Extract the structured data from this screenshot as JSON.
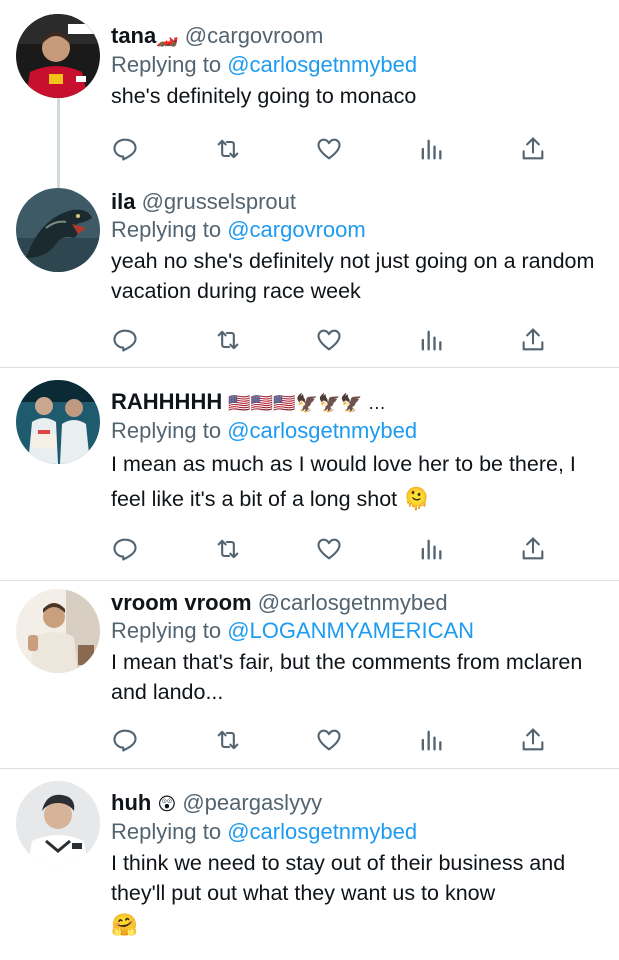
{
  "tweets": [
    {
      "name": "tana",
      "name_suffix": "🏎️",
      "handle": "@cargovroom",
      "replying_prefix": "Replying to",
      "replying_to": "@carlosgetnmybed",
      "text": "she's definitely going to monaco",
      "avatar_icon": "red-racing-driver-avatar",
      "avatar_colors": [
        "#c8102e",
        "#f2c21b",
        "#ffffff"
      ]
    },
    {
      "name": "ila",
      "handle": "@grusselsprout",
      "replying_prefix": "Replying to",
      "replying_to": "@cargovroom",
      "text": "yeah no she's definitely not just going on a random vacation during race week",
      "avatar_icon": "dinosaur-avatar",
      "avatar_colors": [
        "#3d5a66",
        "#1b2a2f",
        "#7a8c80"
      ]
    },
    {
      "name": "RAHHHHH",
      "name_suffix": "🇺🇸🇺🇸🇺🇸🦅🦅🦅 …",
      "handle": "",
      "replying_prefix": "Replying to",
      "replying_to": "@carlosgetnmybed",
      "text": "I mean as much as I would love her to be there, I feel like it's a bit of a long shot 🫠",
      "avatar_icon": "team-photo-avatar",
      "avatar_colors": [
        "#1f5b6f",
        "#e9eef0",
        "#0a2a36"
      ]
    },
    {
      "name": "vroom vroom",
      "handle": "@carlosgetnmybed",
      "replying_prefix": "Replying to",
      "replying_to": "@LOGANMYAMERICAN",
      "text": "I mean that's fair, but the comments from mclaren and lando...",
      "avatar_icon": "thumbs-up-person-avatar",
      "avatar_colors": [
        "#d8cfc2",
        "#8a6a4f",
        "#f3efe8"
      ]
    },
    {
      "name": "huh",
      "name_suffix": "😲",
      "handle": "@peargaslyyy",
      "replying_prefix": "Replying to",
      "replying_to": "@carlosgetnmybed",
      "text": "I think we need to stay out of their business and they'll put out what they want us to know",
      "trailing_emoji": "🤗",
      "avatar_icon": "driver-portrait-avatar",
      "avatar_colors": [
        "#e6e8ea",
        "#2b2f33",
        "#c9a78e"
      ]
    }
  ],
  "actions": [
    "reply-icon",
    "retweet-icon",
    "like-icon",
    "analytics-icon",
    "share-icon"
  ],
  "colors": {
    "text": "#0f1419",
    "secondary": "#536471",
    "mention": "#1d9bf0",
    "separator": "#d9dee2",
    "thread_line": "#cfd9de"
  }
}
